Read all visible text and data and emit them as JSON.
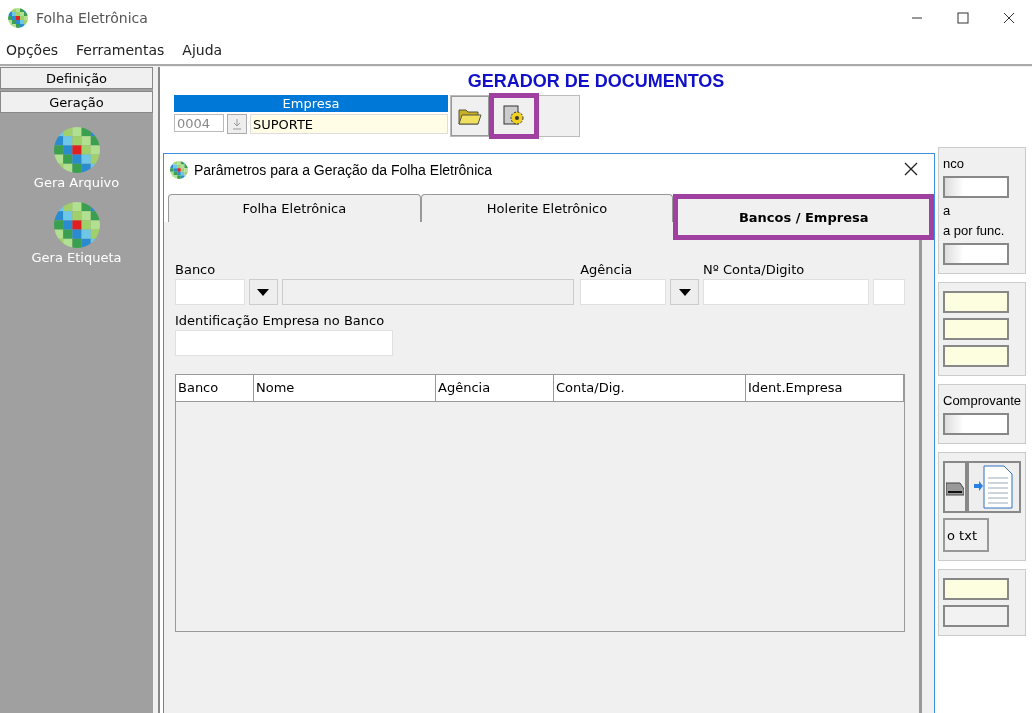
{
  "window": {
    "title": "Folha Eletrônica"
  },
  "menu": [
    "Opções",
    "Ferramentas",
    "Ajuda"
  ],
  "sidebar": {
    "sections": [
      {
        "label": "Definição"
      },
      {
        "label": "Geração"
      }
    ],
    "items": [
      {
        "label": "Gera Arquivo"
      },
      {
        "label": "Gera Etiqueta"
      }
    ]
  },
  "main": {
    "title": "GERADOR DE DOCUMENTOS",
    "empresa": {
      "label": "Empresa",
      "code": "0004",
      "name": "SUPORTE"
    },
    "toolbar": [
      {
        "kind": "open",
        "highlighted": false
      },
      {
        "kind": "settings",
        "highlighted": true
      }
    ],
    "side_panels": [
      {
        "items": [
          {
            "kind": "label",
            "text": "nco"
          },
          {
            "kind": "input"
          },
          {
            "kind": "label",
            "text": "a"
          },
          {
            "kind": "label",
            "text": "a por func."
          },
          {
            "kind": "input"
          }
        ]
      },
      {
        "items": [
          {
            "kind": "highlighted-input"
          },
          {
            "kind": "highlighted-input"
          },
          {
            "kind": "highlighted-input"
          }
        ]
      },
      {
        "items": [
          {
            "kind": "label",
            "text": "Comprovante"
          },
          {
            "kind": "input"
          }
        ]
      },
      {
        "items": [
          {
            "kind": "icons"
          },
          {
            "kind": "button",
            "text": "o txt"
          }
        ]
      },
      {
        "items": [
          {
            "kind": "highlighted-input"
          },
          {
            "kind": "readonly-input"
          }
        ]
      }
    ]
  },
  "dialog": {
    "title": "Parâmetros para a Geração da Folha Eletrônica",
    "tabs": [
      {
        "label": "Folha Eletrônica",
        "selected": false,
        "highlighted": false
      },
      {
        "label": "Holerite Eletrônico",
        "selected": false,
        "highlighted": false
      },
      {
        "label": "Bancos / Empresa",
        "selected": true,
        "highlighted": true
      }
    ],
    "banco": {
      "label": "Banco",
      "name_disabled": true
    },
    "agencia": {
      "label": "Agência"
    },
    "conta": {
      "label": "Nº Conta/Digito"
    },
    "identificacao": {
      "label": "Identificação Empresa no Banco"
    },
    "table": {
      "columns": [
        "Banco",
        "Nome",
        "Agência",
        "Conta/Dig.",
        "Ident.Empresa"
      ]
    }
  }
}
